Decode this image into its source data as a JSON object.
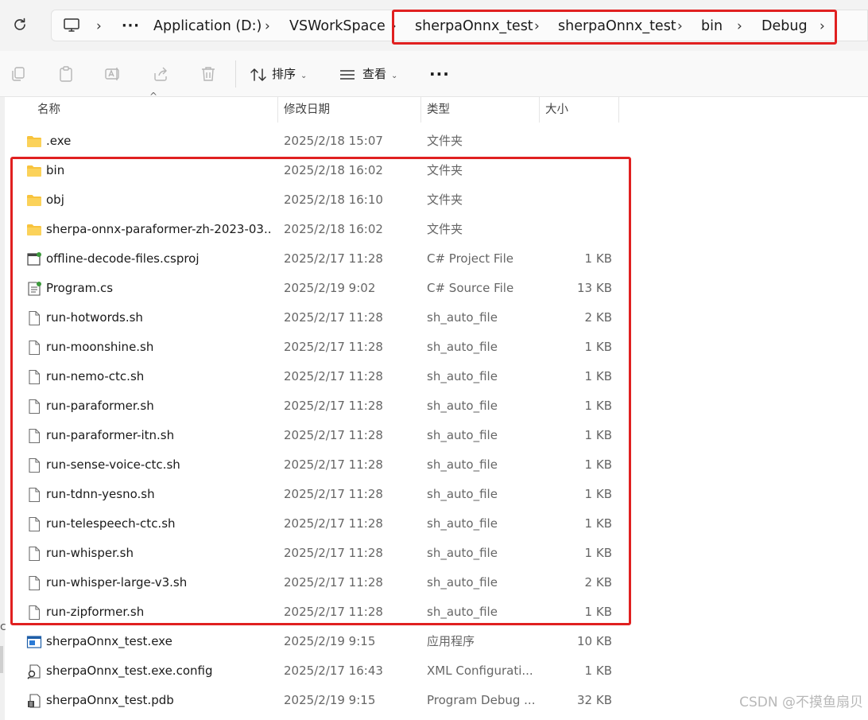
{
  "breadcrumb": {
    "more": "···",
    "items": [
      "Application (D:)",
      "VSWorkSpace",
      "sherpaOnnx_test",
      "sherpaOnnx_test",
      "bin",
      "Debug"
    ]
  },
  "toolbar": {
    "sort_label": "排序",
    "view_label": "查看",
    "more_label": "···"
  },
  "columns": {
    "name": "名称",
    "date": "修改日期",
    "type": "类型",
    "size": "大小"
  },
  "files": [
    {
      "name": ".exe",
      "date": "2025/2/18 15:07",
      "type": "文件夹",
      "size": "",
      "icon": "folder"
    },
    {
      "name": "bin",
      "date": "2025/2/18 16:02",
      "type": "文件夹",
      "size": "",
      "icon": "folder"
    },
    {
      "name": "obj",
      "date": "2025/2/18 16:10",
      "type": "文件夹",
      "size": "",
      "icon": "folder"
    },
    {
      "name": "sherpa-onnx-paraformer-zh-2023-03...",
      "date": "2025/2/18 16:02",
      "type": "文件夹",
      "size": "",
      "icon": "folder"
    },
    {
      "name": "offline-decode-files.csproj",
      "date": "2025/2/17 11:28",
      "type": "C# Project File",
      "size": "1 KB",
      "icon": "csproj"
    },
    {
      "name": "Program.cs",
      "date": "2025/2/19 9:02",
      "type": "C# Source File",
      "size": "13 KB",
      "icon": "cs"
    },
    {
      "name": "run-hotwords.sh",
      "date": "2025/2/17 11:28",
      "type": "sh_auto_file",
      "size": "2 KB",
      "icon": "file"
    },
    {
      "name": "run-moonshine.sh",
      "date": "2025/2/17 11:28",
      "type": "sh_auto_file",
      "size": "1 KB",
      "icon": "file"
    },
    {
      "name": "run-nemo-ctc.sh",
      "date": "2025/2/17 11:28",
      "type": "sh_auto_file",
      "size": "1 KB",
      "icon": "file"
    },
    {
      "name": "run-paraformer.sh",
      "date": "2025/2/17 11:28",
      "type": "sh_auto_file",
      "size": "1 KB",
      "icon": "file"
    },
    {
      "name": "run-paraformer-itn.sh",
      "date": "2025/2/17 11:28",
      "type": "sh_auto_file",
      "size": "1 KB",
      "icon": "file"
    },
    {
      "name": "run-sense-voice-ctc.sh",
      "date": "2025/2/17 11:28",
      "type": "sh_auto_file",
      "size": "1 KB",
      "icon": "file"
    },
    {
      "name": "run-tdnn-yesno.sh",
      "date": "2025/2/17 11:28",
      "type": "sh_auto_file",
      "size": "1 KB",
      "icon": "file"
    },
    {
      "name": "run-telespeech-ctc.sh",
      "date": "2025/2/17 11:28",
      "type": "sh_auto_file",
      "size": "1 KB",
      "icon": "file"
    },
    {
      "name": "run-whisper.sh",
      "date": "2025/2/17 11:28",
      "type": "sh_auto_file",
      "size": "1 KB",
      "icon": "file"
    },
    {
      "name": "run-whisper-large-v3.sh",
      "date": "2025/2/17 11:28",
      "type": "sh_auto_file",
      "size": "2 KB",
      "icon": "file"
    },
    {
      "name": "run-zipformer.sh",
      "date": "2025/2/17 11:28",
      "type": "sh_auto_file",
      "size": "1 KB",
      "icon": "file"
    },
    {
      "name": "sherpaOnnx_test.exe",
      "date": "2025/2/19 9:15",
      "type": "应用程序",
      "size": "10 KB",
      "icon": "exe"
    },
    {
      "name": "sherpaOnnx_test.exe.config",
      "date": "2025/2/17 16:43",
      "type": "XML Configurati...",
      "size": "1 KB",
      "icon": "config"
    },
    {
      "name": "sherpaOnnx_test.pdb",
      "date": "2025/2/19 9:15",
      "type": "Program Debug ...",
      "size": "32 KB",
      "icon": "pdb"
    }
  ],
  "left_edge_glyph": "c",
  "watermark": "CSDN @不摸鱼扇贝",
  "colors": {
    "highlight_box": "#e02020",
    "folder": "#f8c33c"
  }
}
